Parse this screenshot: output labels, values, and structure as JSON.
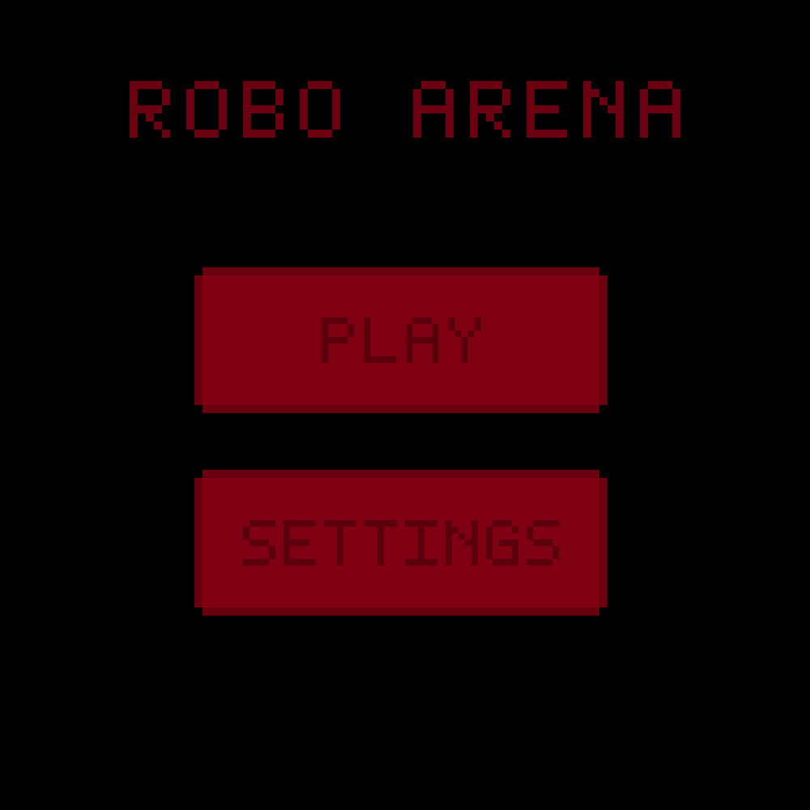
{
  "title": "ROBO ARENA",
  "menu": {
    "play_label": "PLAY",
    "settings_label": "SETTINGS"
  },
  "colors": {
    "background": "#000000",
    "button_fill": "#7f0011",
    "button_edge": "#5e000c",
    "text": "#5a000c",
    "title": "#6a0010"
  }
}
